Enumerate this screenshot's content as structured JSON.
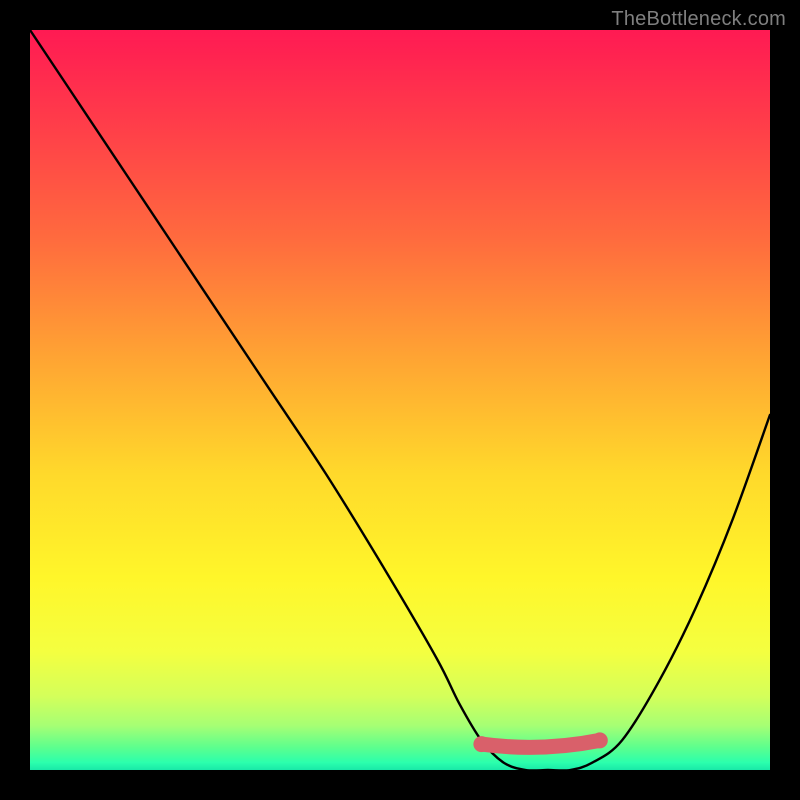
{
  "credit": "TheBottleneck.com",
  "colors": {
    "frame": "#000000",
    "curve_stroke": "#000000",
    "marker_fill": "#d9606a",
    "credit_text": "#7f7f7f"
  },
  "chart_data": {
    "type": "line",
    "title": "",
    "xlabel": "",
    "ylabel": "",
    "xlim": [
      0,
      100
    ],
    "ylim": [
      0,
      100
    ],
    "series": [
      {
        "name": "bottleneck-curve",
        "x": [
          0,
          8,
          16,
          24,
          32,
          40,
          48,
          55,
          58,
          61,
          64,
          67,
          70,
          73,
          76,
          80,
          85,
          90,
          95,
          100
        ],
        "y": [
          100,
          88,
          76,
          64,
          52,
          40,
          27,
          15,
          9,
          4,
          1,
          0,
          0,
          0,
          1,
          4,
          12,
          22,
          34,
          48
        ]
      }
    ],
    "markers": [
      {
        "name": "flat-region-start",
        "x": 61,
        "y": 3.5
      },
      {
        "name": "flat-region-end",
        "x": 77,
        "y": 4
      }
    ]
  }
}
